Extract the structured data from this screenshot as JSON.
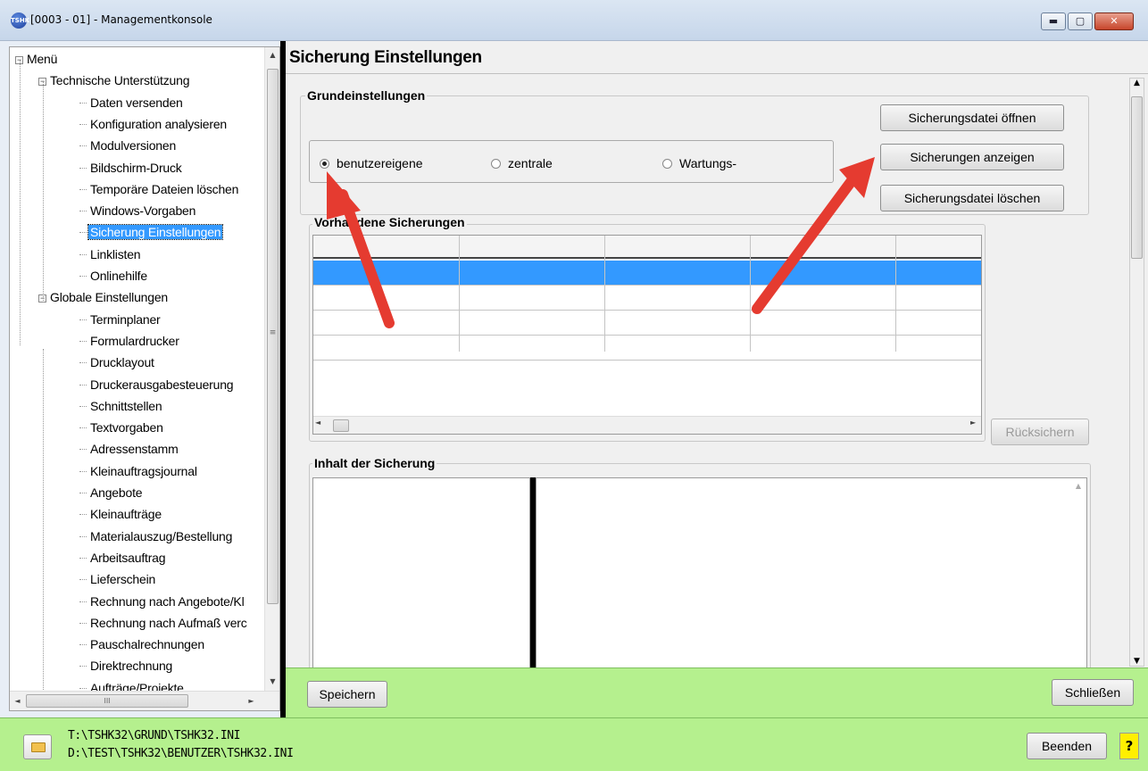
{
  "window": {
    "title": "[0003 - 01] - Managementkonsole",
    "app_icon_text": "TSHK",
    "minimize": "▬",
    "maximize": "▢",
    "close": "✕"
  },
  "tree": {
    "items": [
      {
        "label": "Menü",
        "level": 0,
        "expander": "−"
      },
      {
        "label": "Technische Unterstützung",
        "level": 1,
        "expander": "−"
      },
      {
        "label": "Daten versenden",
        "level": 2
      },
      {
        "label": "Konfiguration analysieren",
        "level": 2
      },
      {
        "label": "Modulversionen",
        "level": 2
      },
      {
        "label": "Bildschirm-Druck",
        "level": 2
      },
      {
        "label": "Temporäre Dateien löschen",
        "level": 2
      },
      {
        "label": "Windows-Vorgaben",
        "level": 2
      },
      {
        "label": "Sicherung Einstellungen",
        "level": 2,
        "selected": true
      },
      {
        "label": "Linklisten",
        "level": 2
      },
      {
        "label": "Onlinehilfe",
        "level": 2
      },
      {
        "label": "Globale Einstellungen",
        "level": 1,
        "expander": "−"
      },
      {
        "label": "Terminplaner",
        "level": 2
      },
      {
        "label": "Formulardrucker",
        "level": 2
      },
      {
        "label": "Drucklayout",
        "level": 2
      },
      {
        "label": "Druckerausgabesteuerung",
        "level": 2
      },
      {
        "label": "Schnittstellen",
        "level": 2
      },
      {
        "label": "Textvorgaben",
        "level": 2
      },
      {
        "label": "Adressenstamm",
        "level": 2
      },
      {
        "label": "Kleinauftragsjournal",
        "level": 2
      },
      {
        "label": "Angebote",
        "level": 2
      },
      {
        "label": "Kleinaufträge",
        "level": 2
      },
      {
        "label": "Materialauszug/Bestellung",
        "level": 2
      },
      {
        "label": "Arbeitsauftrag",
        "level": 2
      },
      {
        "label": "Lieferschein",
        "level": 2
      },
      {
        "label": "Rechnung nach Angebote/Kl",
        "level": 2
      },
      {
        "label": "Rechnung nach Aufmaß verc",
        "level": 2
      },
      {
        "label": "Pauschalrechnungen",
        "level": 2
      },
      {
        "label": "Direktrechnung",
        "level": 2
      },
      {
        "label": "Aufträge/Projekte",
        "level": 2
      }
    ],
    "scroll_up": "▲",
    "scroll_down": "▼",
    "scroll_grip": "≡",
    "hscroll_left": "◄",
    "hscroll_right": "►",
    "hscroll_grip": "III"
  },
  "main": {
    "title": "Sicherung Einstellungen",
    "grundeinstellungen": {
      "label": "Grundeinstellungen",
      "radios": [
        {
          "label": "benutzereigene",
          "checked": true
        },
        {
          "label": "zentrale",
          "checked": false
        },
        {
          "label": "Wartungs-",
          "checked": false
        }
      ]
    },
    "buttons": {
      "open": "Sicherungsdatei öffnen",
      "show": "Sicherungen anzeigen",
      "delete": "Sicherungsdatei löschen",
      "restore": "Rücksichern"
    },
    "vorhandene": {
      "label": "Vorhandene Sicherungen",
      "columns": [
        "",
        "",
        "",
        "",
        ""
      ],
      "selected_row": 0
    },
    "inhalt": {
      "label": "Inhalt der Sicherung"
    },
    "scroll_up": "▲",
    "scroll_down": "▼"
  },
  "footer": {
    "save": "Speichern",
    "close": "Schließen"
  },
  "statusbar": {
    "path1": "T:\\TSHK32\\GRUND\\TSHK32.INI",
    "path2": "D:\\TEST\\TSHK32\\BENUTZER\\TSHK32.INI",
    "quit": "Beenden",
    "help": "?"
  },
  "colors": {
    "selection": "#3399ff",
    "green_bar": "#b5f08e",
    "annotation_arrow": "#e53b30"
  }
}
